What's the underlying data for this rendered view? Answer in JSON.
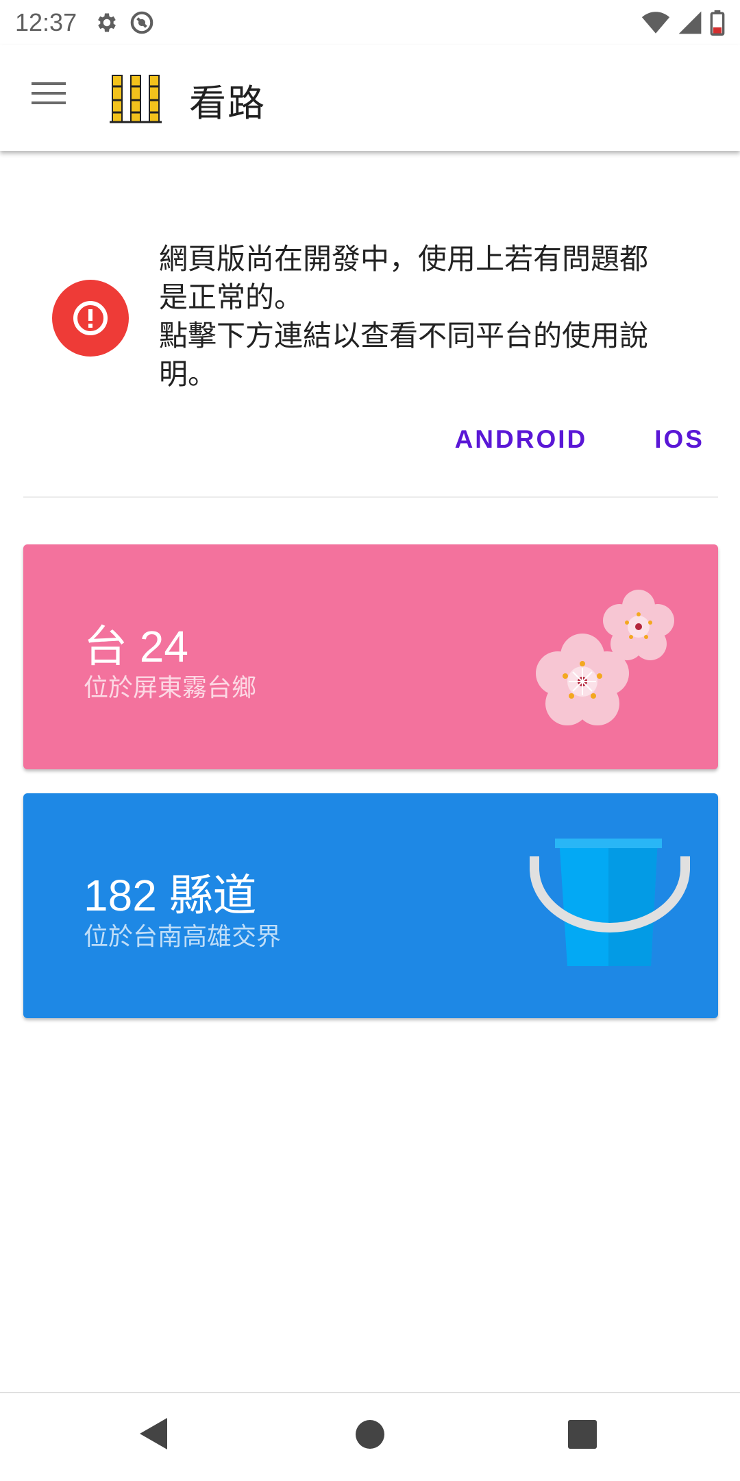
{
  "status_bar": {
    "time": "12:37",
    "left_icons": [
      "gear-icon",
      "do-not-disturb-icon"
    ],
    "right_icons": [
      "wifi-icon",
      "cellular-signal-icon",
      "battery-icon"
    ]
  },
  "app_bar": {
    "menu_icon": "hamburger-menu-icon",
    "logo_icon": "bamboo-pipes-logo",
    "title": "看路"
  },
  "banner": {
    "icon": "alert-circle-icon",
    "message": "網頁版尚在開發中，使用上若有問題都\n是正常的。\n點擊下方連結以查看不同平台的使用說\n明。",
    "actions": [
      "ANDROID",
      "IOS"
    ]
  },
  "cards": [
    {
      "title": "台 24",
      "subtitle": "位於屏東霧台鄉",
      "color": "#f3729d",
      "art": "cherry-blossom-icon"
    },
    {
      "title": "182 縣道",
      "subtitle": "位於台南高雄交界",
      "color": "#1e88e5",
      "art": "bucket-icon"
    }
  ],
  "nav_bar": {
    "buttons": [
      "back-icon",
      "home-icon",
      "recents-icon"
    ]
  },
  "colors": {
    "alert": "#ee3b37",
    "action_text": "#5a17d6",
    "pink_card": "#f3729d",
    "blue_card": "#1e88e5"
  }
}
